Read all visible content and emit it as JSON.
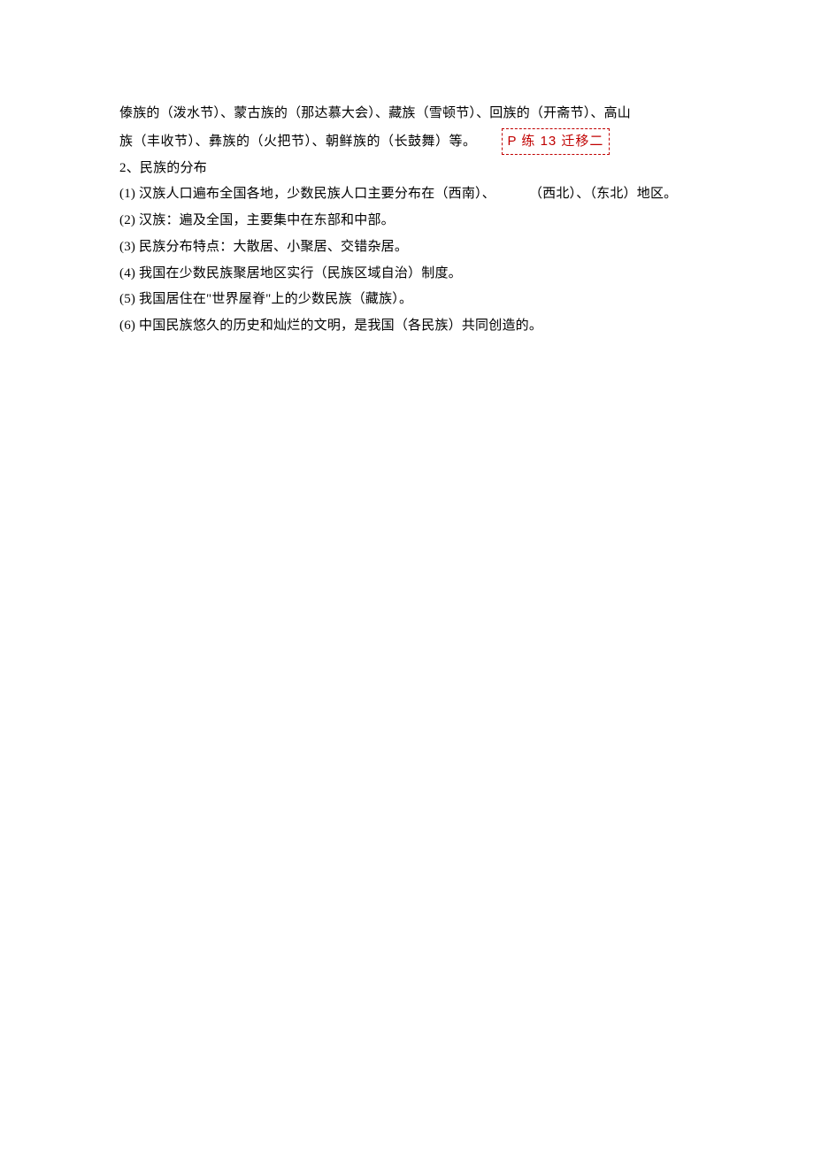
{
  "para1": "傣族的（泼水节）、蒙古族的（那达慕大会）、藏族（雪顿节）、回族的（开斋节）、高山",
  "para2_text": "族（丰收节）、彝族的（火把节）、朝鲜族的（长鼓舞）等。",
  "link_label": "P 练 13  迁移二",
  "section2": "2、民族的分布",
  "items": [
    "(1)  汉族人口遍布全国各地，少数民族人口主要分布在（西南）、",
    "(2)  汉族：遍及全国，主要集中在东部和中部。",
    "(3)  民族分布特点：大散居、小聚居、交错杂居。",
    "(4)  我国在少数民族聚居地区实行（民族区域自治）制度。",
    "(5)  我国居住在\"世界屋脊\"上的少数民族（藏族）。",
    "(6)  中国民族悠久的历史和灿烂的文明，是我国（各民族）共同创造的。"
  ],
  "item1_tail": "（西北）、（东北）地区。"
}
